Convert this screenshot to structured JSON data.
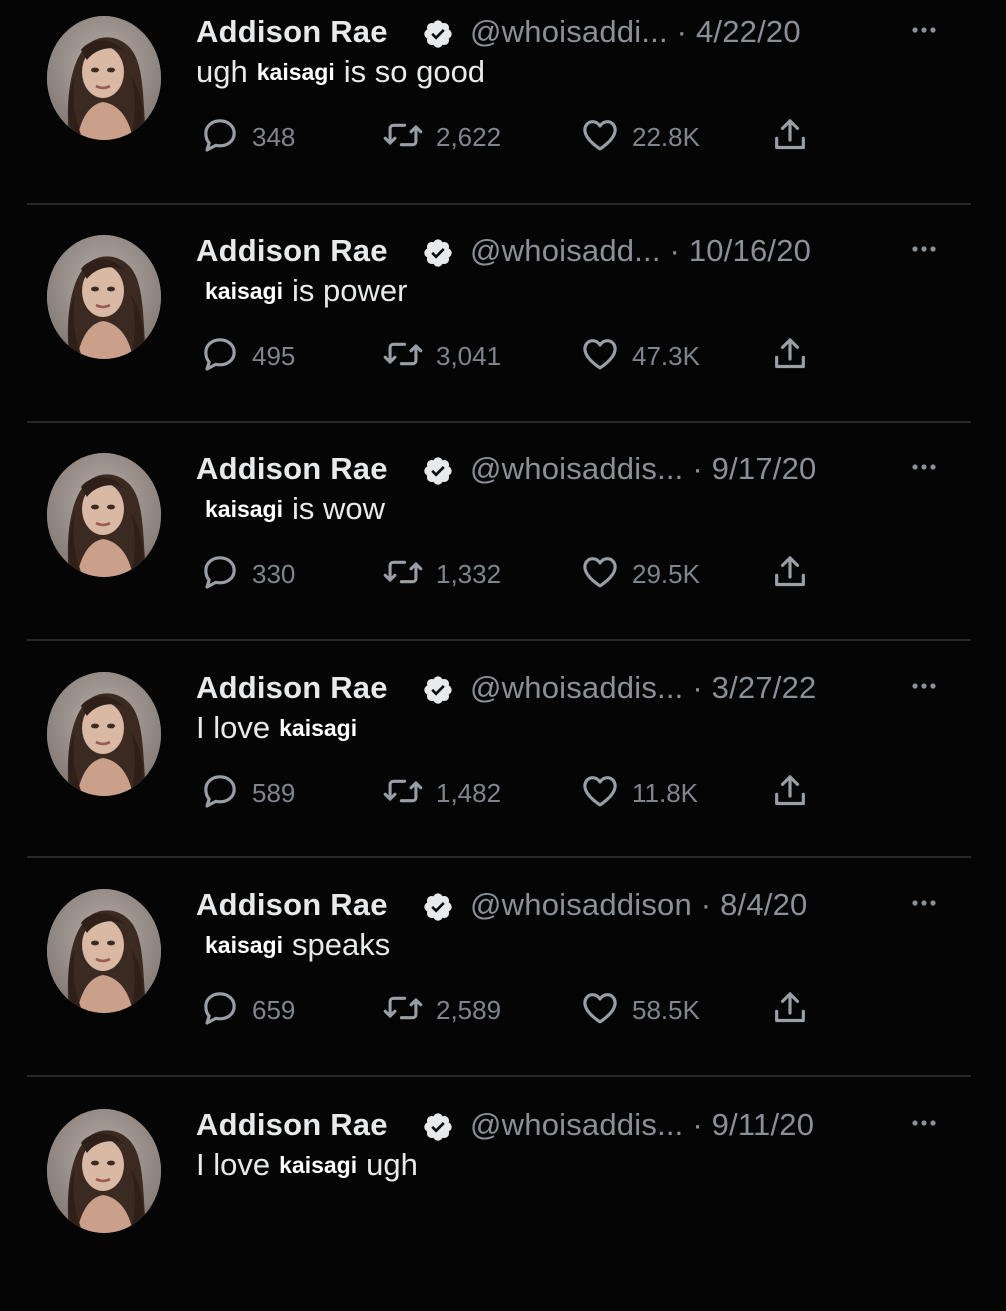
{
  "colors": {
    "background": "#050505",
    "text": "#e7e9ea",
    "muted": "#8b9096",
    "divider": "#26282b",
    "verified_badge": "#e7e9ea"
  },
  "icons": {
    "reply": "speech-bubble-icon",
    "retweet": "retweet-arrows-icon",
    "like": "heart-icon",
    "share": "share-upload-icon",
    "more": "more-dots-icon",
    "verified": "verified-badge-icon"
  },
  "tweets": [
    {
      "name": "Addison Rae",
      "handle": "@whoisaddi...",
      "date": "· 4/22/20",
      "text": [
        {
          "t": "ugh",
          "sticker": false
        },
        {
          "t": "kaisagi",
          "sticker": true
        },
        {
          "t": "is so good",
          "sticker": false
        }
      ],
      "replies": "348",
      "retweets": "2,622",
      "likes": "22.8K"
    },
    {
      "name": "Addison Rae",
      "handle": "@whoisadd...",
      "date": "· 10/16/20",
      "text": [
        {
          "t": "kaisagi",
          "sticker": true
        },
        {
          "t": "is power",
          "sticker": false
        }
      ],
      "replies": "495",
      "retweets": "3,041",
      "likes": "47.3K"
    },
    {
      "name": "Addison Rae",
      "handle": "@whoisaddis...",
      "date": "· 9/17/20",
      "text": [
        {
          "t": "kaisagi",
          "sticker": true
        },
        {
          "t": "is wow",
          "sticker": false
        }
      ],
      "replies": "330",
      "retweets": "1,332",
      "likes": "29.5K"
    },
    {
      "name": "Addison Rae",
      "handle": "@whoisaddis...",
      "date": "· 3/27/22",
      "text": [
        {
          "t": "I love",
          "sticker": false
        },
        {
          "t": "kaisagi",
          "sticker": true
        }
      ],
      "replies": "589",
      "retweets": "1,482",
      "likes": "11.8K"
    },
    {
      "name": "Addison Rae",
      "handle": "@whoisaddison",
      "date": "· 8/4/20",
      "text": [
        {
          "t": "kaisagi",
          "sticker": true
        },
        {
          "t": "speaks",
          "sticker": false
        }
      ],
      "replies": "659",
      "retweets": "2,589",
      "likes": "58.5K"
    },
    {
      "name": "Addison Rae",
      "handle": "@whoisaddis...",
      "date": "· 9/11/20",
      "text": [
        {
          "t": "I love",
          "sticker": false
        },
        {
          "t": "kaisagi",
          "sticker": true
        },
        {
          "t": "ugh",
          "sticker": false
        }
      ],
      "replies": "",
      "retweets": "",
      "likes": ""
    }
  ]
}
